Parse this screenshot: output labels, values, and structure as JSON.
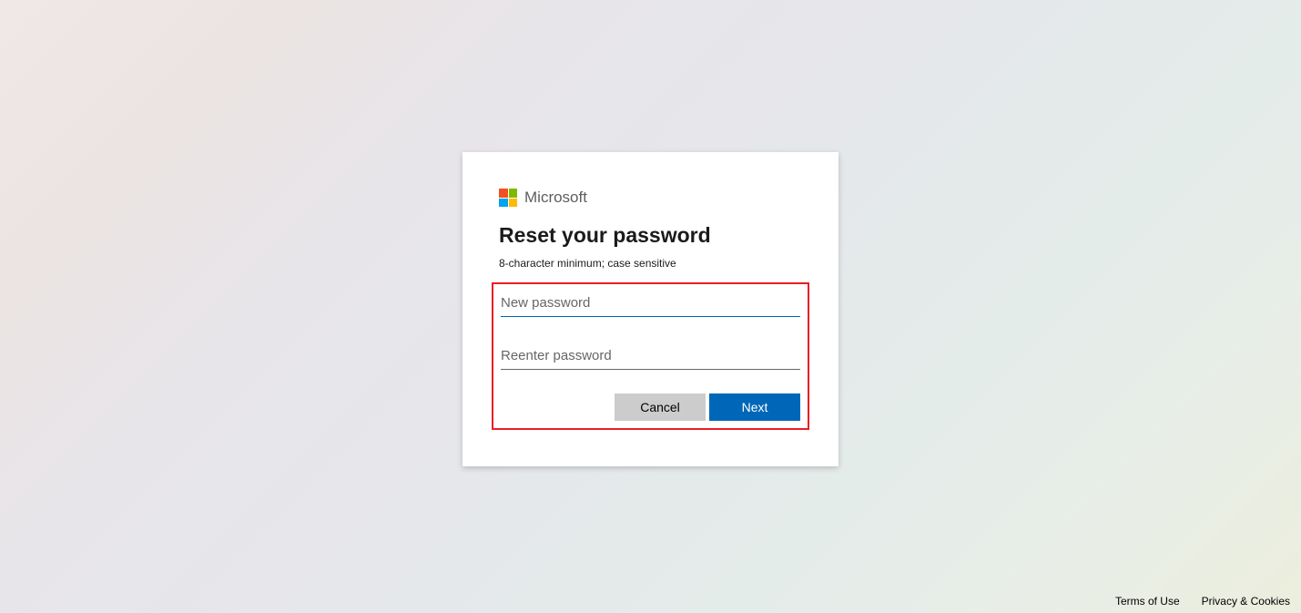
{
  "brand": "Microsoft",
  "heading": "Reset your password",
  "hint": "8-character minimum; case sensitive",
  "inputs": {
    "new_password_placeholder": "New password",
    "reenter_password_placeholder": "Reenter password"
  },
  "buttons": {
    "cancel": "Cancel",
    "next": "Next"
  },
  "footer": {
    "terms": "Terms of Use",
    "privacy": "Privacy & Cookies"
  }
}
